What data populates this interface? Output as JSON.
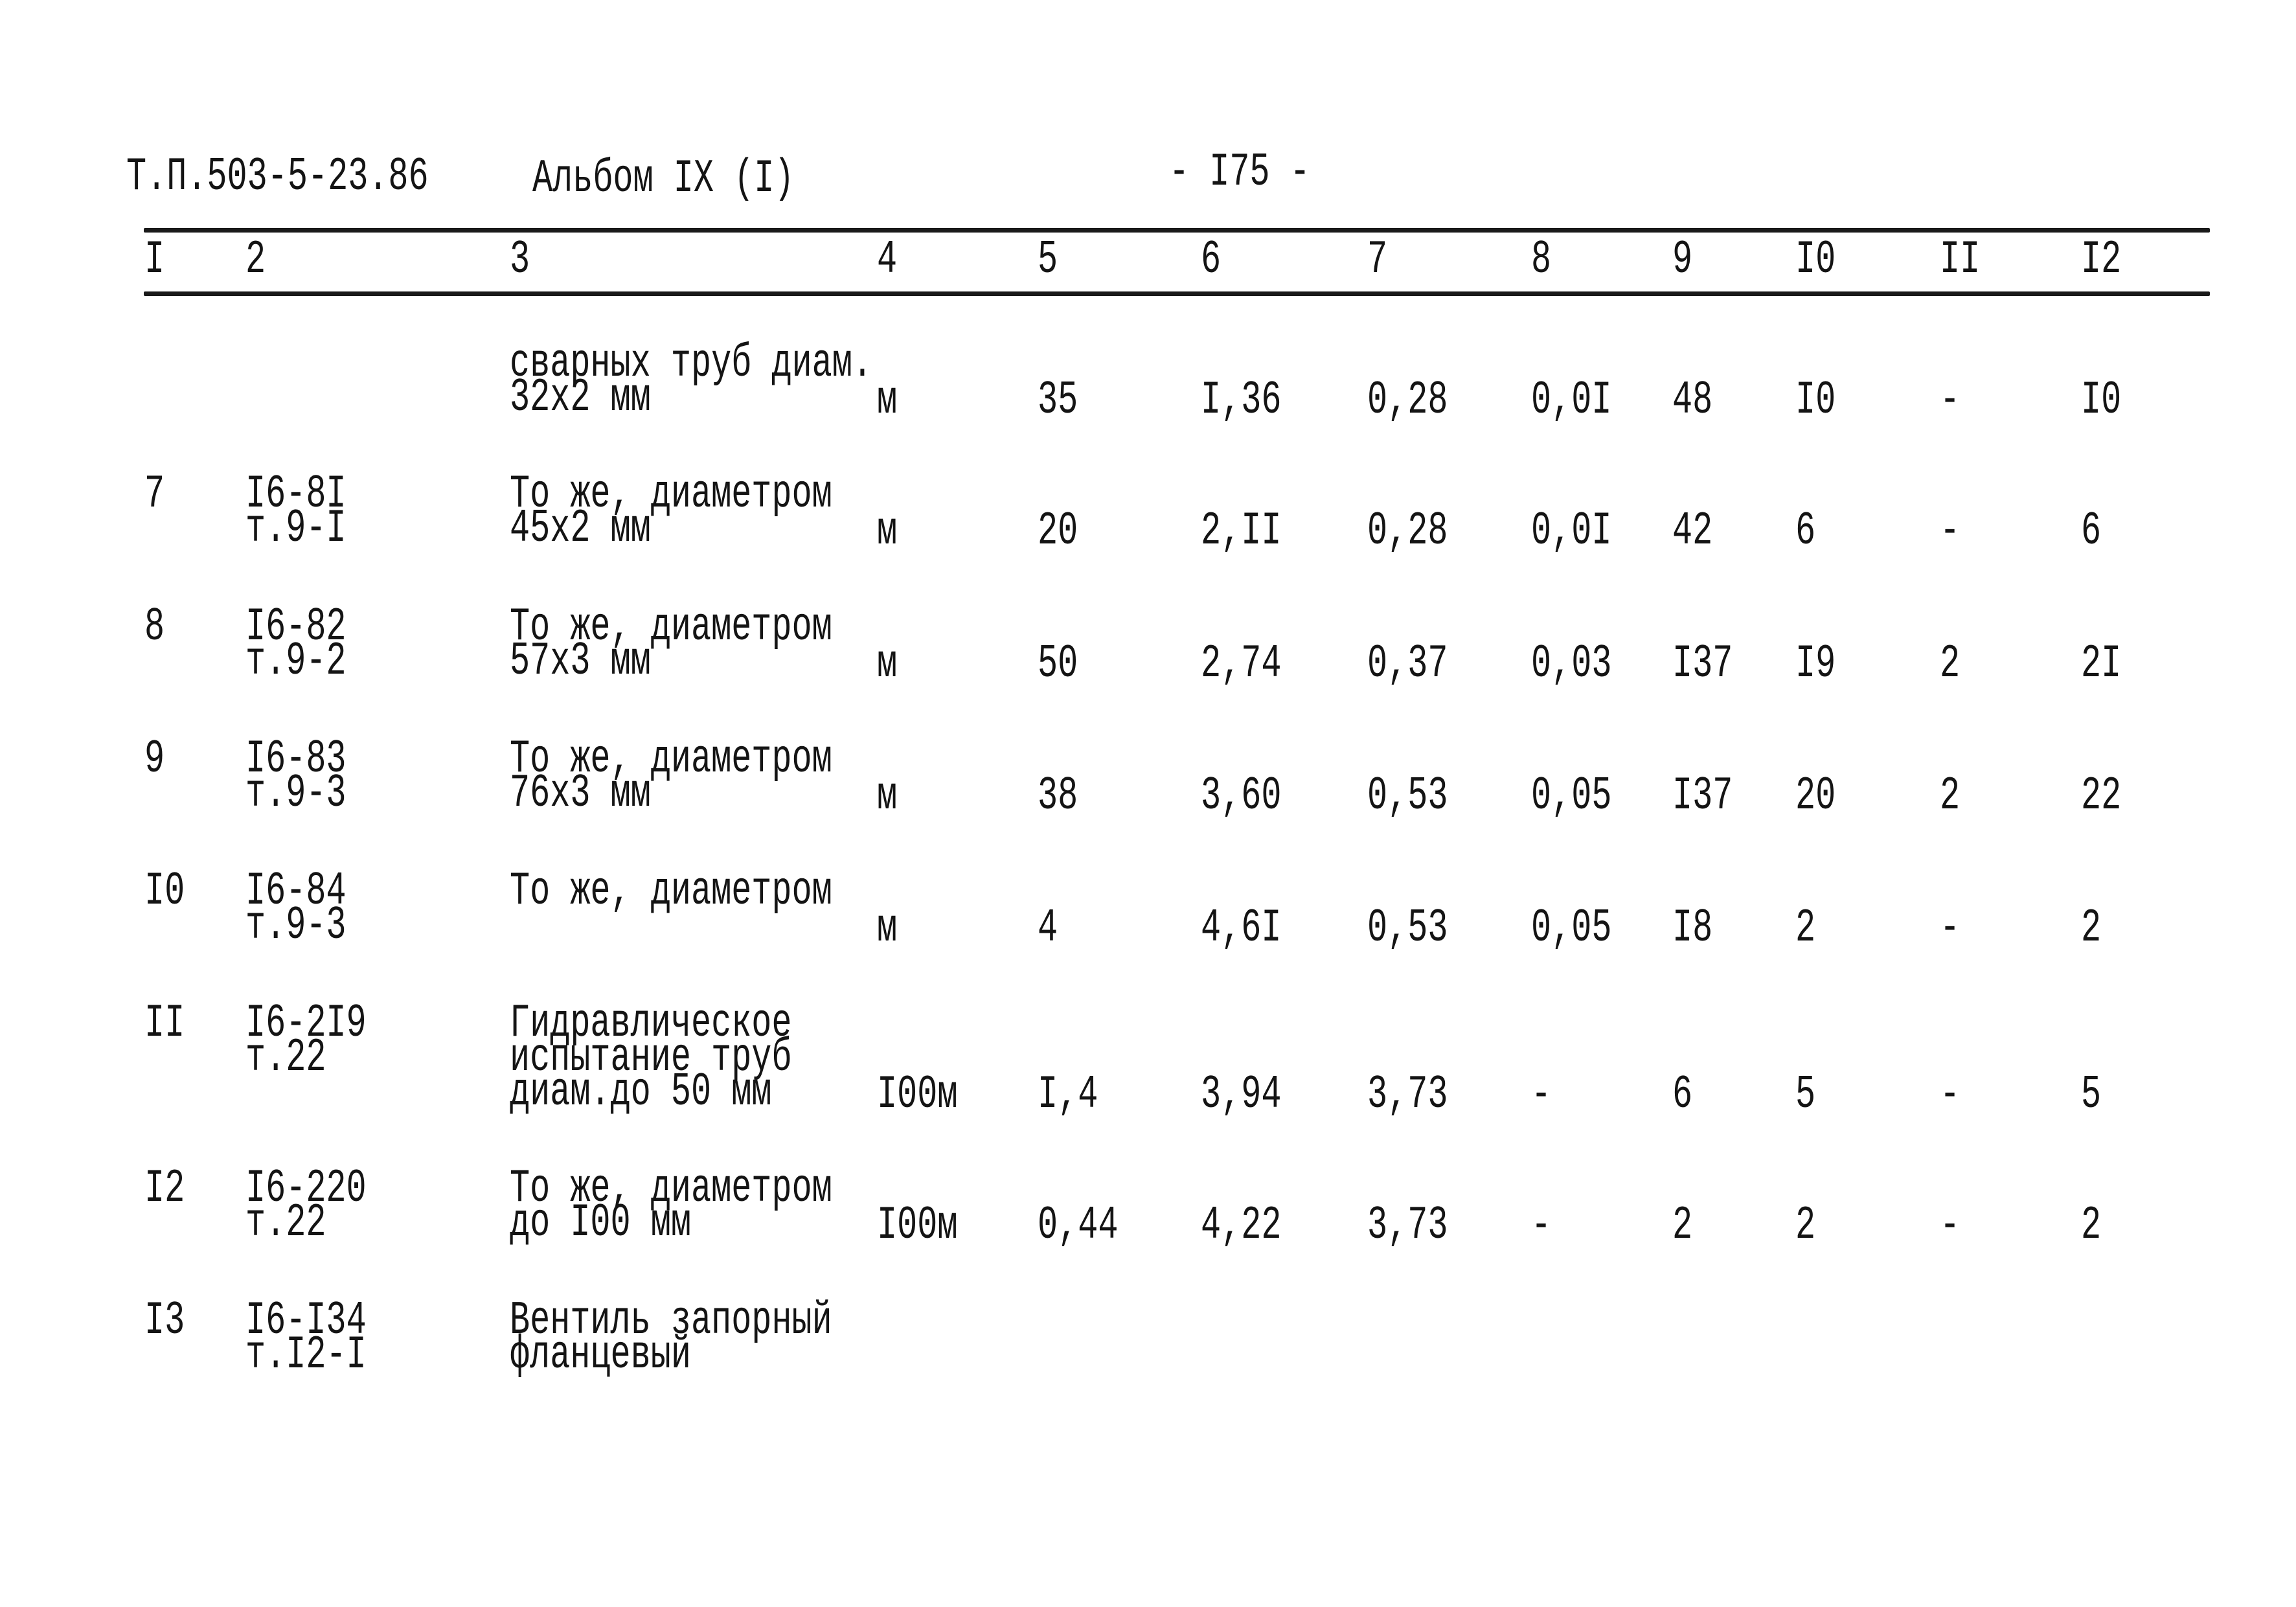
{
  "header": {
    "doc_code": "Т.П.503-5-23.86",
    "album": "Альбом IX (I)",
    "page_number": "- I75 -"
  },
  "table": {
    "column_headers": [
      "I",
      "2",
      "3",
      "4",
      "5",
      "6",
      "7",
      "8",
      "9",
      "I0",
      "II",
      "I2"
    ],
    "rows": [
      {
        "num": "",
        "code": [],
        "description": [
          "сварных труб диам.",
          "32х2 мм"
        ],
        "unit": "м",
        "c5": "35",
        "c6": "I,36",
        "c7": "0,28",
        "c8": "0,0I",
        "c9": "48",
        "c10": "I0",
        "c11": "-",
        "c12": "I0"
      },
      {
        "num": "7",
        "code": [
          "I6-8I",
          "т.9-I"
        ],
        "description": [
          "То же, диаметром",
          "45х2 мм"
        ],
        "unit": "м",
        "c5": "20",
        "c6": "2,II",
        "c7": "0,28",
        "c8": "0,0I",
        "c9": "42",
        "c10": "6",
        "c11": "-",
        "c12": "6"
      },
      {
        "num": "8",
        "code": [
          "I6-82",
          "т.9-2"
        ],
        "description": [
          "То же, диаметром",
          "57х3 мм"
        ],
        "unit": "м",
        "c5": "50",
        "c6": "2,74",
        "c7": "0,37",
        "c8": "0,03",
        "c9": "I37",
        "c10": "I9",
        "c11": "2",
        "c12": "2I"
      },
      {
        "num": "9",
        "code": [
          "I6-83",
          "т.9-3"
        ],
        "description": [
          "То же, диаметром",
          "76х3 мм"
        ],
        "unit": "м",
        "c5": "38",
        "c6": "3,60",
        "c7": "0,53",
        "c8": "0,05",
        "c9": "I37",
        "c10": "20",
        "c11": "2",
        "c12": "22"
      },
      {
        "num": "I0",
        "code": [
          "I6-84",
          "т.9-3"
        ],
        "description": [
          "То же, диаметром"
        ],
        "unit": "м",
        "c5": "4",
        "c6": "4,6I",
        "c7": "0,53",
        "c8": "0,05",
        "c9": "I8",
        "c10": "2",
        "c11": "-",
        "c12": "2"
      },
      {
        "num": "II",
        "code": [
          "I6-2I9",
          "т.22"
        ],
        "description": [
          "Гидравлическое",
          "испытание труб",
          "диам.до 50 мм"
        ],
        "unit": "I00м",
        "c5": "I,4",
        "c6": "3,94",
        "c7": "3,73",
        "c8": "-",
        "c9": "6",
        "c10": "5",
        "c11": "-",
        "c12": "5"
      },
      {
        "num": "I2",
        "code": [
          "I6-220",
          "т.22"
        ],
        "description": [
          "То же, диаметром",
          "до I00 мм"
        ],
        "unit": "I00м",
        "c5": "0,44",
        "c6": "4,22",
        "c7": "3,73",
        "c8": "-",
        "c9": "2",
        "c10": "2",
        "c11": "-",
        "c12": "2"
      },
      {
        "num": "I3",
        "code": [
          "I6-I34",
          "т.I2-I"
        ],
        "description": [
          "Вентиль запорный",
          "фланцевый"
        ],
        "unit": "",
        "c5": "",
        "c6": "",
        "c7": "",
        "c8": "",
        "c9": "",
        "c10": "",
        "c11": "",
        "c12": ""
      }
    ]
  }
}
